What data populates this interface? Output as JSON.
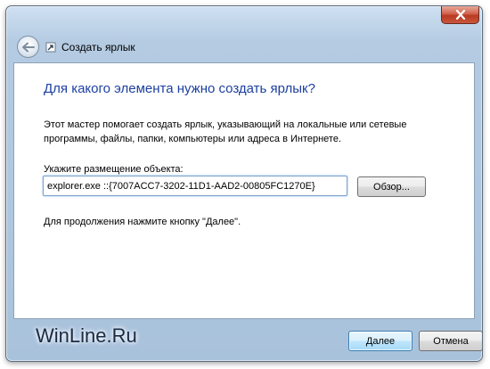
{
  "window": {
    "title": "Создать ярлык"
  },
  "content": {
    "heading": "Для какого элемента нужно создать ярлык?",
    "description": "Этот мастер помогает создать ярлык, указывающий на локальные или сетевые программы, файлы, папки, компьютеры или адреса в Интернете.",
    "field_label": "Укажите размещение объекта:",
    "path_value": "explorer.exe ::{7007ACC7-3202-11D1-AAD2-00805FC1270E}",
    "browse_label": "Обзор...",
    "continue_hint": "Для продолжения нажмите кнопку \"Далее\"."
  },
  "footer": {
    "watermark": "WinLine.Ru",
    "next_label": "Далее",
    "cancel_label": "Отмена"
  },
  "icons": {
    "close": "close-icon",
    "back": "back-arrow-icon",
    "wizard": "shortcut-wizard-icon"
  },
  "colors": {
    "heading": "#1c3fa0",
    "close_button": "#c9573c",
    "default_button_border": "#3c7fb1"
  }
}
